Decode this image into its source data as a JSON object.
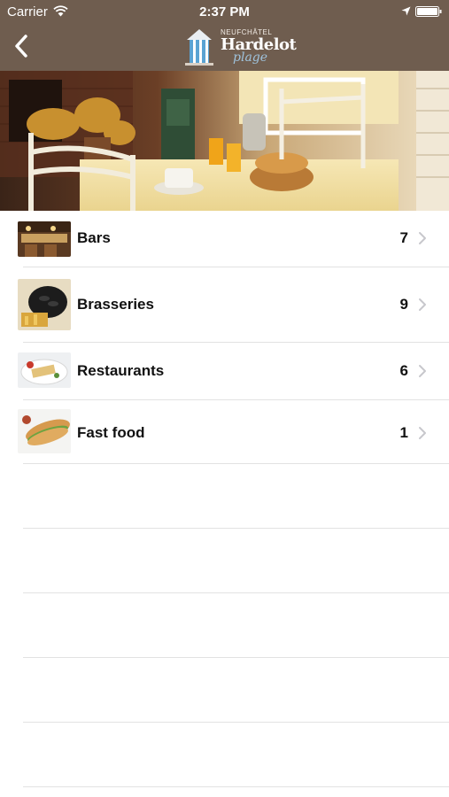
{
  "status_bar": {
    "carrier": "Carrier",
    "time": "2:37 PM",
    "wifi_icon": "wifi-icon",
    "location_icon": "location-arrow-icon",
    "battery_icon": "battery-icon"
  },
  "nav": {
    "back_icon": "chevron-left-icon",
    "logo": {
      "line1": "NEUFCHÂTEL",
      "line2": "Hardelot",
      "line3": "plage"
    },
    "bar_color": "#6f5d4f"
  },
  "categories": [
    {
      "label": "Bars",
      "count": "7",
      "thumb": "bar-interior-photo"
    },
    {
      "label": "Brasseries",
      "count": "9",
      "thumb": "mussels-dish-photo"
    },
    {
      "label": "Restaurants",
      "count": "6",
      "thumb": "plated-dish-photo"
    },
    {
      "label": "Fast food",
      "count": "1",
      "thumb": "sandwich-photo"
    }
  ]
}
